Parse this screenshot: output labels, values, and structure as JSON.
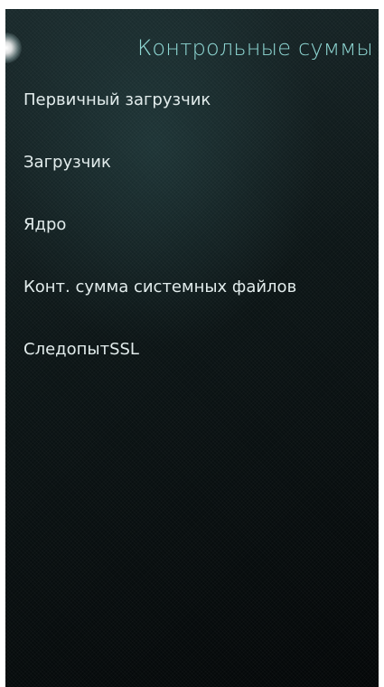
{
  "header": {
    "title": "Контрольные суммы"
  },
  "menu": {
    "items": [
      {
        "label": "Первичный загрузчик"
      },
      {
        "label": "Загрузчик"
      },
      {
        "label": "Ядро"
      },
      {
        "label": "Конт. сумма системных файлов"
      },
      {
        "label": "СледопытSSL"
      }
    ]
  },
  "colors": {
    "accent": "#8fd8d4",
    "text": "#e2ecec",
    "background": "#0c1516"
  }
}
